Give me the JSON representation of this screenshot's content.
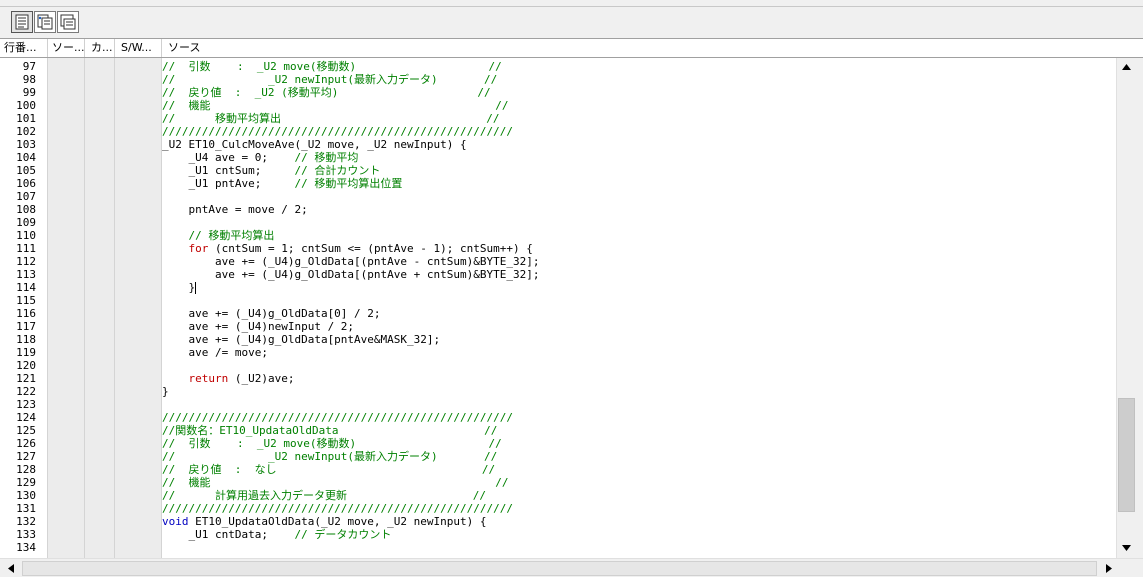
{
  "toolbar": {
    "buttons": [
      {
        "icon": "source-view-icon",
        "pressed": true
      },
      {
        "icon": "mixed-view-icon",
        "pressed": false
      },
      {
        "icon": "disassembly-view-icon",
        "pressed": false
      }
    ]
  },
  "columns": [
    "行番...",
    "ソー...",
    "カ...",
    "S/W...",
    "ソース"
  ],
  "lines": [
    {
      "n": "97",
      "code": [
        {
          "t": "//  引数    :  _U2 move(移動数)                    //",
          "c": "cmt"
        }
      ]
    },
    {
      "n": "98",
      "code": [
        {
          "t": "//              _U2 newInput(最新入力データ)       //",
          "c": "cmt"
        }
      ]
    },
    {
      "n": "99",
      "code": [
        {
          "t": "//  戻り値  :  _U2 (移動平均)                     //",
          "c": "cmt"
        }
      ]
    },
    {
      "n": "100",
      "code": [
        {
          "t": "//  機能                                           //",
          "c": "cmt"
        }
      ]
    },
    {
      "n": "101",
      "code": [
        {
          "t": "//      移動平均算出                               //",
          "c": "cmt"
        }
      ]
    },
    {
      "n": "102",
      "code": [
        {
          "t": "/////////////////////////////////////////////////////",
          "c": "cmt"
        }
      ]
    },
    {
      "n": "103",
      "code": [
        {
          "t": "_U2 ET10_CulcMoveAve(_U2 move, _U2 newInput) {",
          "c": ""
        }
      ]
    },
    {
      "n": "104",
      "code": [
        {
          "t": "    _U4 ave = 0;    ",
          "c": ""
        },
        {
          "t": "// 移動平均",
          "c": "cmt"
        }
      ]
    },
    {
      "n": "105",
      "code": [
        {
          "t": "    _U1 cntSum;     ",
          "c": ""
        },
        {
          "t": "// 合計カウント",
          "c": "cmt"
        }
      ]
    },
    {
      "n": "106",
      "code": [
        {
          "t": "    _U1 pntAve;     ",
          "c": ""
        },
        {
          "t": "// 移動平均算出位置",
          "c": "cmt"
        }
      ]
    },
    {
      "n": "107",
      "code": []
    },
    {
      "n": "108",
      "code": [
        {
          "t": "    pntAve = move / 2;",
          "c": ""
        }
      ]
    },
    {
      "n": "109",
      "code": []
    },
    {
      "n": "110",
      "code": [
        {
          "t": "    ",
          "c": ""
        },
        {
          "t": "// 移動平均算出",
          "c": "cmt"
        }
      ]
    },
    {
      "n": "111",
      "code": [
        {
          "t": "    ",
          "c": ""
        },
        {
          "t": "for",
          "c": "kw"
        },
        {
          "t": " (cntSum = 1; cntSum <= (pntAve - 1); cntSum++) {",
          "c": ""
        }
      ]
    },
    {
      "n": "112",
      "code": [
        {
          "t": "        ave += (_U4)g_OldData[(pntAve - cntSum)&BYTE_32];",
          "c": ""
        }
      ]
    },
    {
      "n": "113",
      "code": [
        {
          "t": "        ave += (_U4)g_OldData[(pntAve + cntSum)&BYTE_32];",
          "c": ""
        }
      ]
    },
    {
      "n": "114",
      "code": [
        {
          "t": "    }",
          "c": "",
          "caret": true
        }
      ]
    },
    {
      "n": "115",
      "code": []
    },
    {
      "n": "116",
      "code": [
        {
          "t": "    ave += (_U4)g_OldData[0] / 2;",
          "c": ""
        }
      ]
    },
    {
      "n": "117",
      "code": [
        {
          "t": "    ave += (_U4)newInput / 2;",
          "c": ""
        }
      ]
    },
    {
      "n": "118",
      "code": [
        {
          "t": "    ave += (_U4)g_OldData[pntAve&MASK_32];",
          "c": ""
        }
      ]
    },
    {
      "n": "119",
      "code": [
        {
          "t": "    ave /= move;",
          "c": ""
        }
      ]
    },
    {
      "n": "120",
      "code": []
    },
    {
      "n": "121",
      "code": [
        {
          "t": "    ",
          "c": ""
        },
        {
          "t": "return",
          "c": "kw"
        },
        {
          "t": " (_U2)ave;",
          "c": ""
        }
      ]
    },
    {
      "n": "122",
      "code": [
        {
          "t": "}",
          "c": ""
        }
      ]
    },
    {
      "n": "123",
      "code": []
    },
    {
      "n": "124",
      "code": [
        {
          "t": "/////////////////////////////////////////////////////",
          "c": "cmt"
        }
      ]
    },
    {
      "n": "125",
      "code": [
        {
          "t": "//関数名：ET10_UpdataOldData                      //",
          "c": "cmt"
        }
      ]
    },
    {
      "n": "126",
      "code": [
        {
          "t": "//  引数    :  _U2 move(移動数)                    //",
          "c": "cmt"
        }
      ]
    },
    {
      "n": "127",
      "code": [
        {
          "t": "//              _U2 newInput(最新入力データ)       //",
          "c": "cmt"
        }
      ]
    },
    {
      "n": "128",
      "code": [
        {
          "t": "//  戻り値  :  なし                               //",
          "c": "cmt"
        }
      ]
    },
    {
      "n": "129",
      "code": [
        {
          "t": "//  機能                                           //",
          "c": "cmt"
        }
      ]
    },
    {
      "n": "130",
      "code": [
        {
          "t": "//      計算用過去入力データ更新                   //",
          "c": "cmt"
        }
      ]
    },
    {
      "n": "131",
      "code": [
        {
          "t": "/////////////////////////////////////////////////////",
          "c": "cmt"
        }
      ]
    },
    {
      "n": "132",
      "code": [
        {
          "t": "void",
          "c": "kw2"
        },
        {
          "t": " ET10_UpdataOldData(_U2 move, _U2 newInput) {",
          "c": ""
        }
      ]
    },
    {
      "n": "133",
      "code": [
        {
          "t": "    _U1 cntData;    ",
          "c": ""
        },
        {
          "t": "// データカウント",
          "c": "cmt"
        }
      ]
    },
    {
      "n": "134",
      "code": []
    }
  ]
}
